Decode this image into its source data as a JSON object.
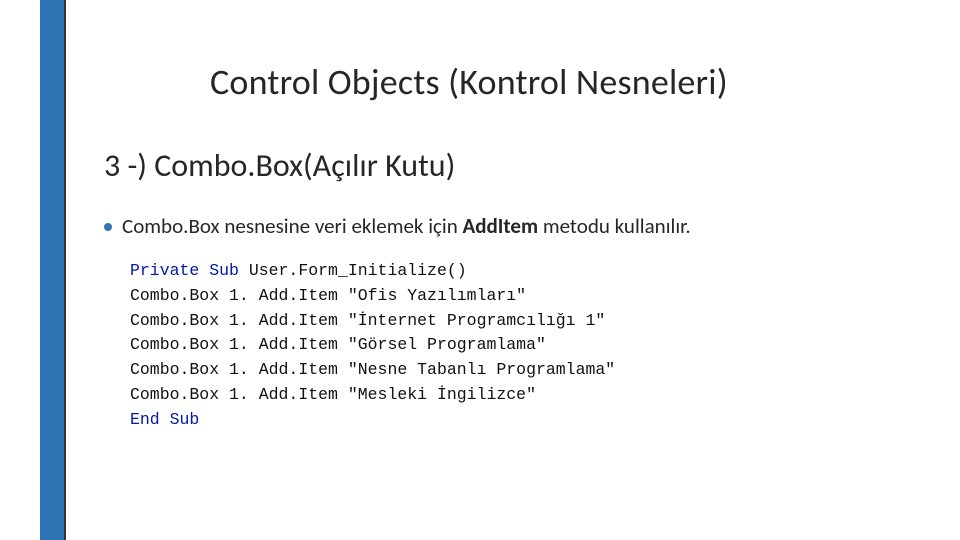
{
  "title": "Control Objects (Kontrol Nesneleri)",
  "subtitle": "3 -) Combo.Box(Açılır Kutu)",
  "bullet": {
    "prefix": "Combo.Box nesnesine veri eklemek için ",
    "strong": "AddItem",
    "suffix": " metodu kullanılır."
  },
  "code": {
    "kw_open": "Private Sub",
    "sub_name": " User.Form_Initialize()",
    "lines": [
      {
        "obj": "Combo.Box 1. Add.Item ",
        "val": "\"Ofis Yazılımları\""
      },
      {
        "obj": "Combo.Box 1. Add.Item ",
        "val": "\"İnternet Programcılığı 1\""
      },
      {
        "obj": "Combo.Box 1. Add.Item ",
        "val": "\"Görsel Programlama\""
      },
      {
        "obj": "Combo.Box 1. Add.Item ",
        "val": "\"Nesne Tabanlı Programlama\""
      },
      {
        "obj": "Combo.Box 1. Add.Item ",
        "val": "\"Mesleki İngilizce\""
      }
    ],
    "kw_close": "End Sub"
  }
}
